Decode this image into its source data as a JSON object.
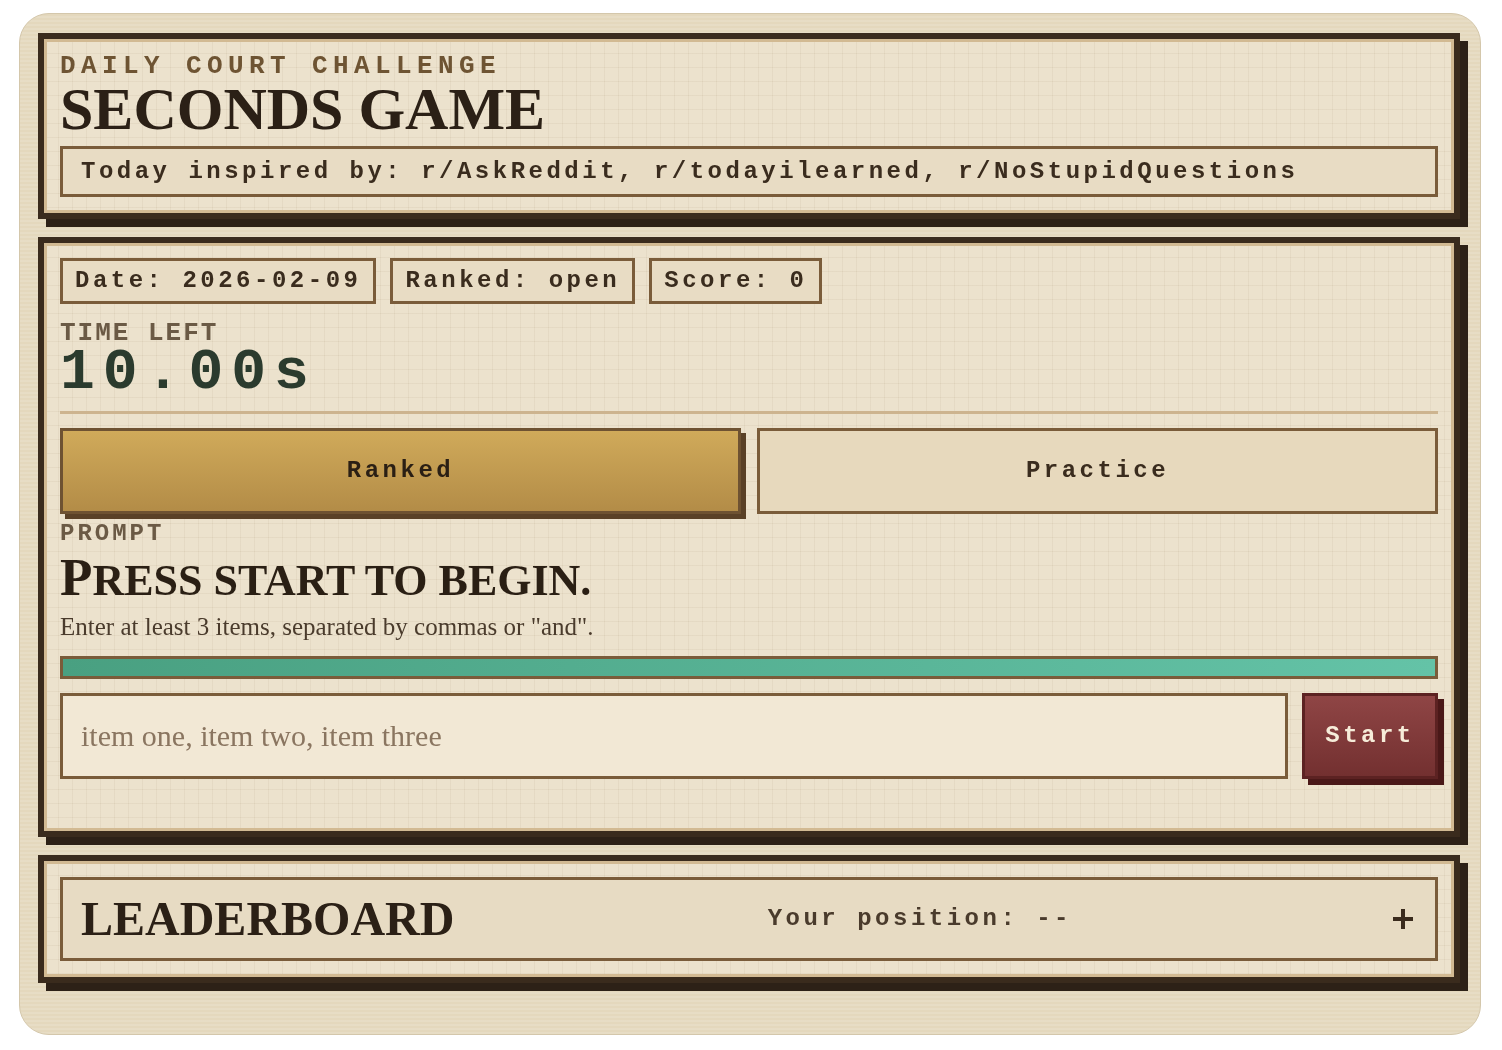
{
  "header": {
    "eyebrow": "DAILY COURT CHALLENGE",
    "title": "SECONDS GAME",
    "inspiration": "Today inspired by: r/AskReddit, r/todayilearned, r/NoStupidQuestions"
  },
  "game": {
    "chips": [
      "Date: 2026-02-09",
      "Ranked: open",
      "Score: 0"
    ],
    "timer": {
      "label": "TIME LEFT",
      "value": "10.00s"
    },
    "modes": [
      {
        "label": "Ranked",
        "selected": true
      },
      {
        "label": "Practice",
        "selected": false
      }
    ],
    "prompt": {
      "label": "PROMPT",
      "text": "PRESS START TO BEGIN.",
      "hint": "Enter at least 3 items, separated by commas or \"and\"."
    },
    "time_bar": {
      "level": 1
    },
    "answer": {
      "placeholder": "item one, item two, item three"
    },
    "start_button": "Start"
  },
  "leaderboard": {
    "title": "LEADERBOARD",
    "position": "Your position: --",
    "expanded": false
  }
}
